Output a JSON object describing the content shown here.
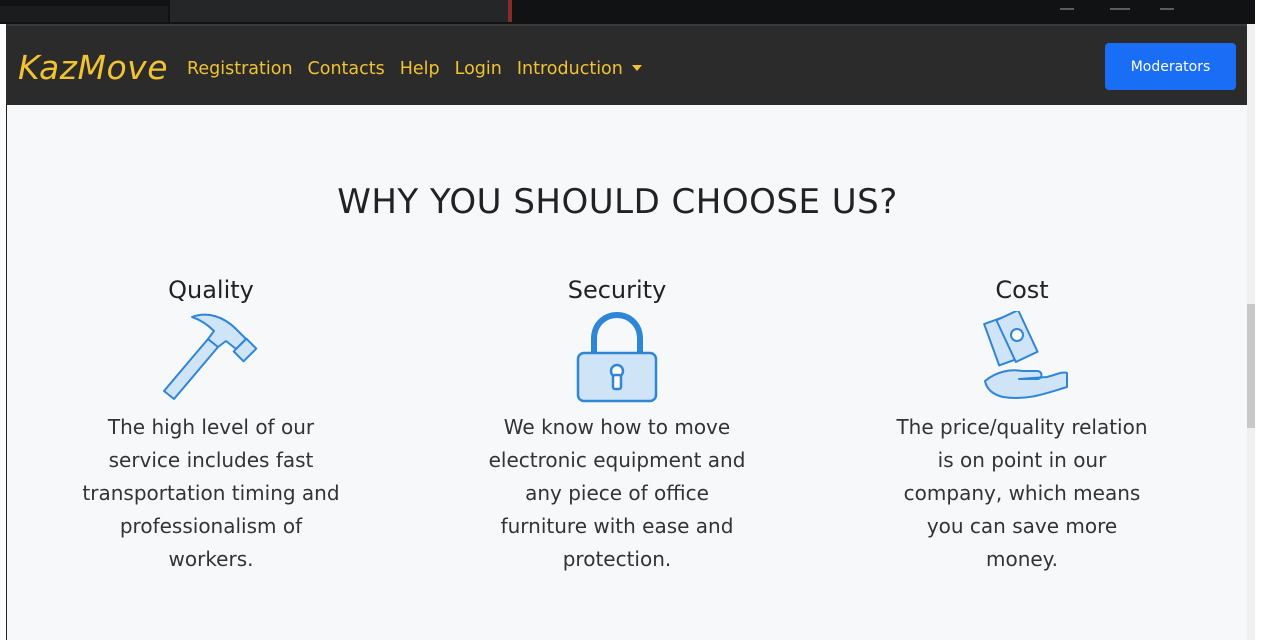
{
  "navbar": {
    "brand": "KazMove",
    "links": [
      {
        "label": "Registration"
      },
      {
        "label": "Contacts"
      },
      {
        "label": "Help"
      },
      {
        "label": "Login"
      },
      {
        "label": "Introduction"
      }
    ],
    "moderators_label": "Moderators"
  },
  "section": {
    "heading": "WHY YOU SHOULD CHOOSE US?",
    "features": [
      {
        "title": "Quality",
        "icon": "hammer-icon",
        "text": "The high level of our service includes fast transportation timing and professionalism of workers."
      },
      {
        "title": "Security",
        "icon": "padlock-icon",
        "text": "We know how to move electronic equipment and any piece of office furniture with ease and protection."
      },
      {
        "title": "Cost",
        "icon": "money-hand-icon",
        "text": "The price/quality relation is on point in our company, which means you can save more money."
      }
    ]
  },
  "colors": {
    "brand_yellow": "#f1c232",
    "navbar_bg": "#2b2b2b",
    "button_blue": "#1a6ef5",
    "icon_fill": "#cfe4f7",
    "icon_stroke": "#2f86d6"
  }
}
